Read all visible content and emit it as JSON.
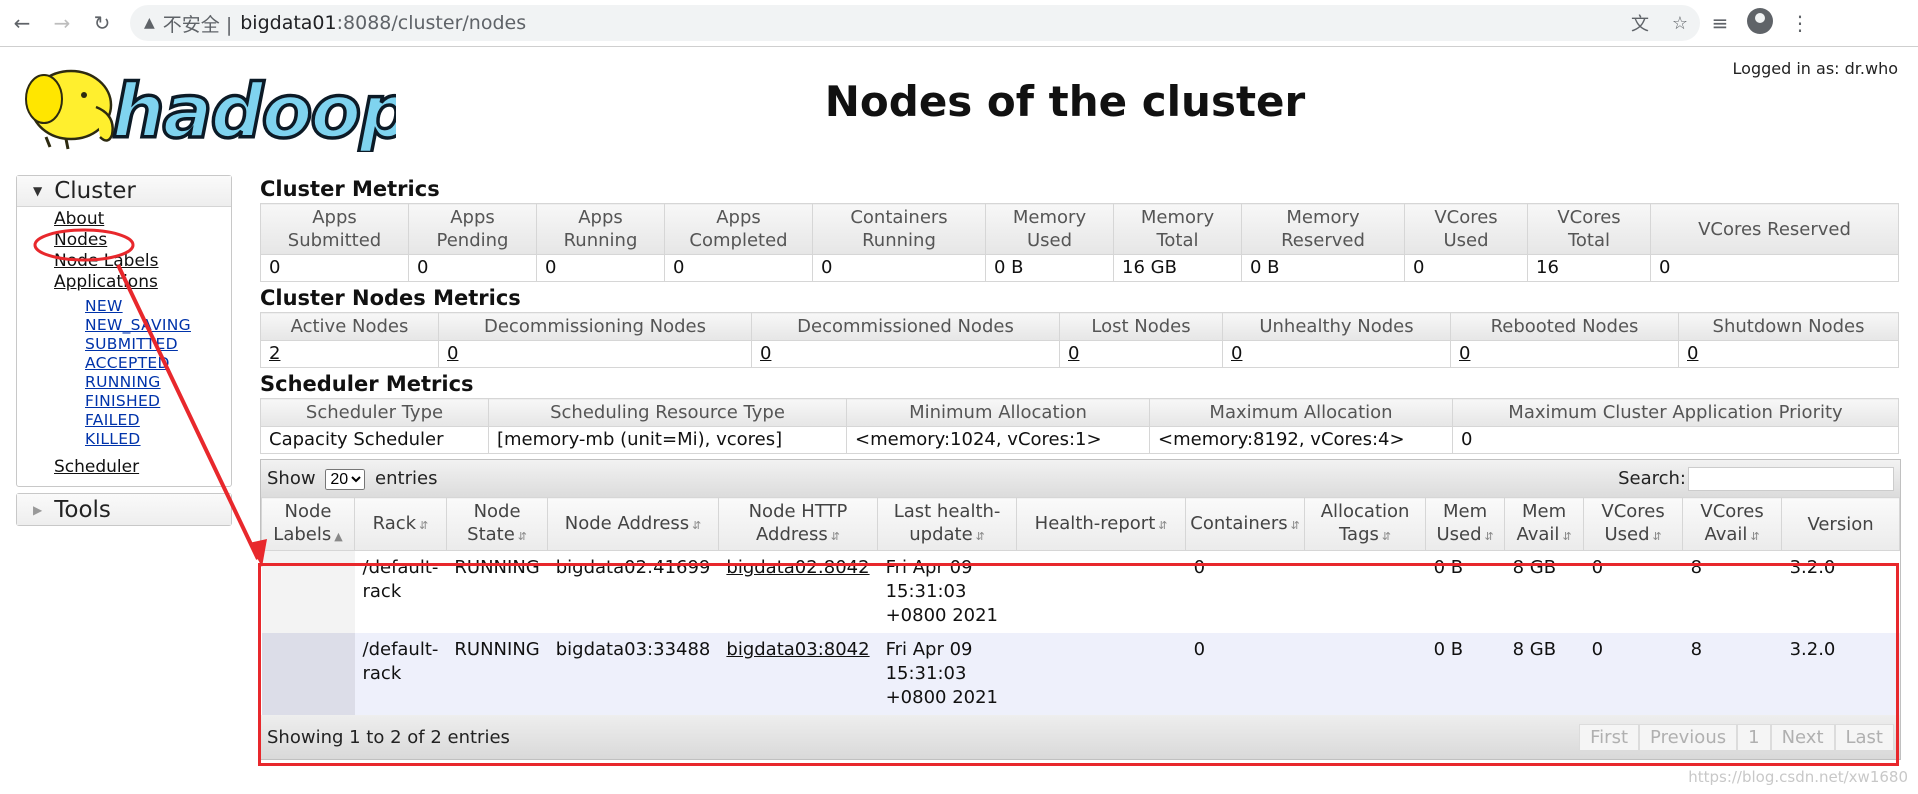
{
  "browser": {
    "insecure_label": "不安全 |",
    "url_host": "bigdata01",
    "url_rest": ":8088/cluster/nodes"
  },
  "header": {
    "logo_text": "hadoop",
    "title": "Nodes of the cluster",
    "logged_in": "Logged in as: dr.who"
  },
  "sidebar": {
    "cluster_label": "Cluster",
    "links": [
      "About",
      "Nodes",
      "Node Labels",
      "Applications"
    ],
    "app_states": [
      "NEW",
      "NEW_SAVING",
      "SUBMITTED",
      "ACCEPTED",
      "RUNNING",
      "FINISHED",
      "FAILED",
      "KILLED"
    ],
    "scheduler": "Scheduler",
    "tools_label": "Tools"
  },
  "cluster_metrics": {
    "title": "Cluster Metrics",
    "headers": [
      "Apps Submitted",
      "Apps Pending",
      "Apps Running",
      "Apps Completed",
      "Containers Running",
      "Memory Used",
      "Memory Total",
      "Memory Reserved",
      "VCores Used",
      "VCores Total",
      "VCores Reserved"
    ],
    "values": [
      "0",
      "0",
      "0",
      "0",
      "0",
      "0 B",
      "16 GB",
      "0 B",
      "0",
      "16",
      "0"
    ]
  },
  "cluster_nodes_metrics": {
    "title": "Cluster Nodes Metrics",
    "headers": [
      "Active Nodes",
      "Decommissioning Nodes",
      "Decommissioned Nodes",
      "Lost Nodes",
      "Unhealthy Nodes",
      "Rebooted Nodes",
      "Shutdown Nodes"
    ],
    "values": [
      "2",
      "0",
      "0",
      "0",
      "0",
      "0",
      "0"
    ]
  },
  "scheduler_metrics": {
    "title": "Scheduler Metrics",
    "headers": [
      "Scheduler Type",
      "Scheduling Resource Type",
      "Minimum Allocation",
      "Maximum Allocation",
      "Maximum Cluster Application Priority"
    ],
    "values": [
      "Capacity Scheduler",
      "[memory-mb (unit=Mi), vcores]",
      "<memory:1024, vCores:1>",
      "<memory:8192, vCores:4>",
      "0"
    ]
  },
  "nodes_table": {
    "show_label": "Show",
    "page_size": "20",
    "entries_label": "entries",
    "search_label": "Search:",
    "headers": [
      "Node Labels",
      "Rack",
      "Node State",
      "Node Address",
      "Node HTTP Address",
      "Last health-update",
      "Health-report",
      "Containers",
      "Allocation Tags",
      "Mem Used",
      "Mem Avail",
      "VCores Used",
      "VCores Avail",
      "Version"
    ],
    "rows": [
      [
        "",
        "/default-rack",
        "RUNNING",
        "bigdata02:41699",
        "bigdata02:8042",
        "Fri Apr 09 15:31:03 +0800 2021",
        "",
        "0",
        "",
        "0 B",
        "8 GB",
        "0",
        "8",
        "3.2.0"
      ],
      [
        "",
        "/default-rack",
        "RUNNING",
        "bigdata03:33488",
        "bigdata03:8042",
        "Fri Apr 09 15:31:03 +0800 2021",
        "",
        "0",
        "",
        "0 B",
        "8 GB",
        "0",
        "8",
        "3.2.0"
      ]
    ],
    "info": "Showing 1 to 2 of 2 entries",
    "pager": [
      "First",
      "Previous",
      "1",
      "Next",
      "Last"
    ]
  },
  "watermark": "https://blog.csdn.net/xw1680",
  "colors": {
    "annotation": "#e8282c",
    "link": "#0033aa"
  }
}
